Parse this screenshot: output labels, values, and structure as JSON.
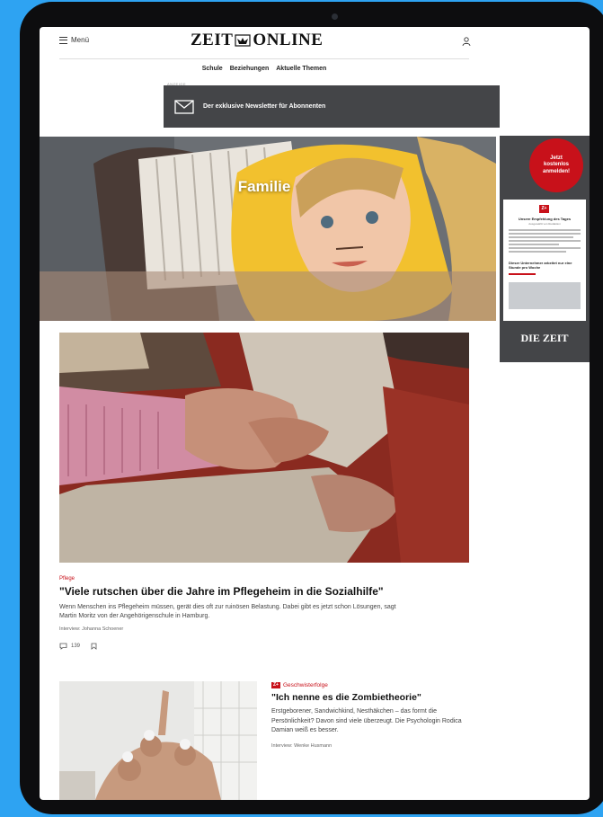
{
  "header": {
    "menu_label": "Menü",
    "logo_left": "ZEIT",
    "logo_right": "ONLINE",
    "nav": [
      "Schule",
      "Beziehungen",
      "Aktuelle Themen"
    ]
  },
  "ad": {
    "label": "ANZEIGE",
    "newsletter_text": "Der exklusive Newsletter für Abonnenten",
    "badge_line1": "Jetzt",
    "badge_line2": "kostenlos",
    "badge_line3": "anmelden!",
    "promo_logo": "Z+",
    "promo_title": "Unsere Empfehlung des Tages",
    "promo_subtitle": "Ausgewählt von Redaktion",
    "promo_headline": "Dieser Unternehmer arbeitet nur eine Stunde pro Woche",
    "brand": "DIE ZEIT"
  },
  "hero": {
    "title": "Familie"
  },
  "article1": {
    "kicker": "Pflege",
    "headline": "\"Viele rutschen über die Jahre im Pflegeheim in die Sozialhilfe\"",
    "teaser": "Wenn Menschen ins Pflegeheim müssen, gerät dies oft zur ruinösen Belastung. Dabei gibt es jetzt schon Lösungen, sagt Martin Moritz von der Angehörigenschule in Hamburg.",
    "byline": "Interview: Johanna Schoener",
    "comments": "139"
  },
  "article2": {
    "badge": "Z+",
    "kicker": "Geschwisterfolge",
    "headline": "\"Ich nenne es die Zombietheorie\"",
    "teaser": "Erstgeborener, Sandwichkind, Nesthäkchen – das formt die Persönlichkeit? Davon sind viele überzeugt. Die Psychologin Rodica Damian weiß es besser.",
    "byline": "Interview: Wenke Husmann"
  },
  "colors": {
    "accent": "#c8111a",
    "ad_bg": "#444548",
    "device_bg": "#2ea3f2"
  }
}
